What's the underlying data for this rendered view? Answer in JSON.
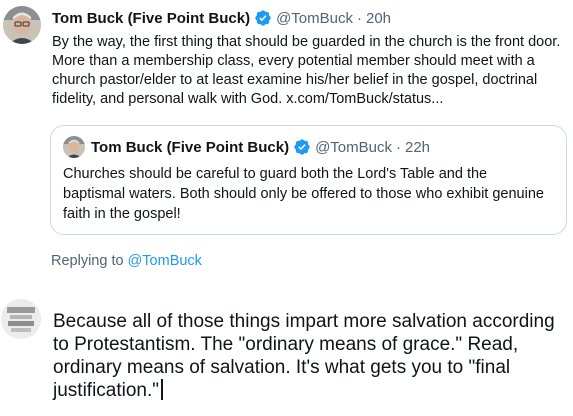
{
  "tweet": {
    "author_name": "Tom Buck (Five Point Buck)",
    "handle": "@TomBuck",
    "separator": "·",
    "time": "20h",
    "text": "By the way, the first thing that should be guarded in the church is the front door. More than a membership class, every potential member should meet with a church pastor/elder to at least examine his/her belief in the gospel, doctrinal fidelity, and  personal walk with God. x.com/TomBuck/status..."
  },
  "quoted_tweet": {
    "author_name": "Tom Buck (Five Point Buck)",
    "handle": "@TomBuck",
    "separator": "·",
    "time": "22h",
    "text": "Churches should be careful to guard both the Lord's Table and the baptismal waters. Both should only be offered to those who exhibit genuine faith in the gospel!"
  },
  "replying": {
    "prefix": "Replying to ",
    "mention": "@TomBuck"
  },
  "compose": {
    "text": "Because all of those things impart more salvation according to Protestantism. The \"ordinary means of grace.\" Read, ordinary means of salvation. It's what gets you to \"final justification.\""
  },
  "icons": {
    "verified": "verified-badge-icon",
    "verified_color": "#1d9bf0"
  }
}
